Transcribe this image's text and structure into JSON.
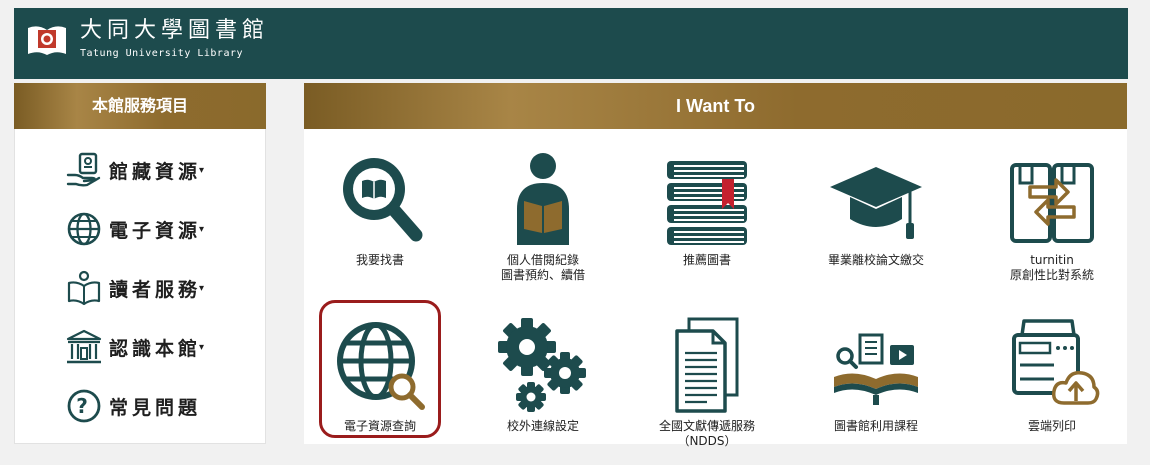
{
  "header": {
    "title_zh": "大同大學圖書館",
    "title_en": "Tatung University Library"
  },
  "sidebar": {
    "heading": "本館服務項目",
    "items": [
      {
        "label": "館藏資源",
        "caret": "▾"
      },
      {
        "label": "電子資源",
        "caret": "▾"
      },
      {
        "label": "讀者服務",
        "caret": "▾"
      },
      {
        "label": "認識本館",
        "caret": "▾"
      },
      {
        "label": "常見問題",
        "caret": ""
      }
    ]
  },
  "main": {
    "heading": "I Want To",
    "tiles": [
      {
        "label": "我要找書",
        "icon": "book-search-icon"
      },
      {
        "label": "個人借閱紀錄\n圖書預約、續借",
        "icon": "reader-icon"
      },
      {
        "label": "推薦圖書",
        "icon": "books-stack-icon"
      },
      {
        "label": "畢業離校論文繳交",
        "icon": "graduation-cap-icon"
      },
      {
        "label": "turnitin\n原創性比對系統",
        "icon": "document-compare-icon"
      },
      {
        "label": "電子資源查詢",
        "icon": "globe-search-icon",
        "highlighted": true
      },
      {
        "label": "校外連線設定",
        "icon": "gears-icon"
      },
      {
        "label": "全國文獻傳遞服務\n（NDDS）",
        "icon": "documents-icon"
      },
      {
        "label": "圖書館利用課程",
        "icon": "open-book-media-icon"
      },
      {
        "label": "雲端列印",
        "icon": "cloud-printer-icon"
      }
    ]
  },
  "colors": {
    "header_bg": "#1d4b4d",
    "icon_teal": "#1d4b4d",
    "gold": "#8e6b2e",
    "highlight": "#9a1c1c"
  }
}
